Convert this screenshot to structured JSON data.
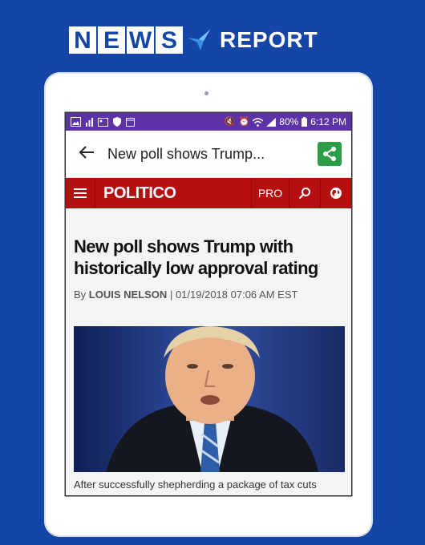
{
  "promo": {
    "news_letters": [
      "N",
      "E",
      "W",
      "S"
    ],
    "report_label": "REPORT"
  },
  "status_bar": {
    "battery": "80%",
    "time": "6:12 PM"
  },
  "app_bar": {
    "title": "New poll shows Trump..."
  },
  "politico_bar": {
    "logo": "POLITICO",
    "pro_label": "PRO"
  },
  "article": {
    "headline": "New poll shows Trump with historically low approval rating",
    "by_prefix": "By",
    "author": "LOUIS NELSON",
    "separator": "|",
    "date": "01/19/2018 07:06 AM EST",
    "caption": "After successfully shepherding a package of tax cuts"
  },
  "colors": {
    "background": "#1545a6",
    "status_bar": "#5b33a6",
    "politico_red": "#b50f0f",
    "share_green": "#2e9d48"
  },
  "icons": [
    "back-arrow-icon",
    "share-icon",
    "menu-icon",
    "search-icon",
    "globe-icon",
    "gallery-icon",
    "wifi-icon",
    "signal-icon",
    "battery-icon",
    "mute-icon",
    "alarm-icon"
  ]
}
